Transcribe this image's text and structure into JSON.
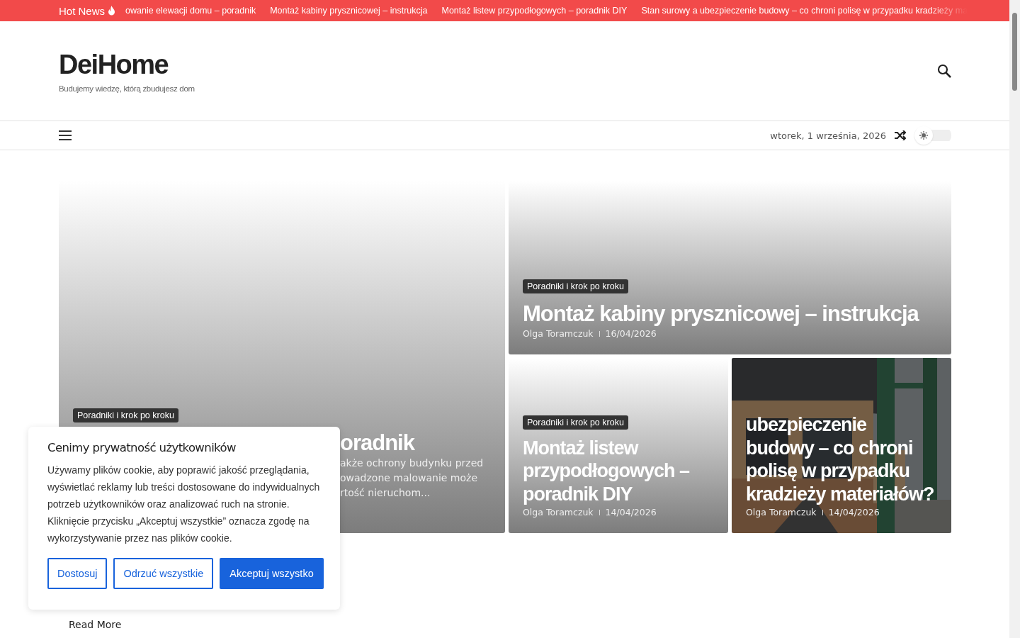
{
  "ticker": {
    "label": "Hot News",
    "items": [
      "owanie elewacji domu – poradnik",
      "Montaż kabiny prysznicowej – instrukcja",
      "Montaż listew przypodłogowych – poradnik DIY",
      "Stan surowy a ubezpieczenie budowy – co chroni polisę w przypadku kradzieży ma"
    ]
  },
  "header": {
    "logo": "DeiHome",
    "tagline": "Budujemy wiedzę, którą zbudujesz dom"
  },
  "nav": {
    "date": "wtorek, 1 września, 2026",
    "dark_mode": false
  },
  "featured": [
    {
      "kind": "large",
      "category": "Poradniki i krok po kroku",
      "title": "oradnik",
      "excerpt_lines": [
        "akże ochrony budynku przed",
        "owadzone malowanie może",
        "rtość nieruchom..."
      ]
    },
    {
      "kind": "wide",
      "category": "Poradniki i krok po kroku",
      "title": "Montaż kabiny prysznicowej – instrukcja",
      "author": "Olga Toramczuk",
      "date": "16/04/2026"
    },
    {
      "kind": "small",
      "category": "Poradniki i krok po kroku",
      "title": "Montaż listew przypodłogowych – poradnik DIY",
      "author": "Olga Toramczuk",
      "date": "14/04/2026"
    },
    {
      "title": "ubezpieczenie budowy – co chroni polisę w przypadku kradzieży materiałów?",
      "author": "Olga Toramczuk",
      "date": "14/04/2026"
    }
  ],
  "latest": {
    "read_more": "Read More"
  },
  "cookie": {
    "title": "Cenimy prywatność użytkowników",
    "text": "Używamy plików cookie, aby poprawić jakość przeglądania, wyświetlać reklamy lub treści dostosowane do indywidualnych potrzeb użytkowników oraz analizować ruch na stronie. Kliknięcie przycisku „Akceptuj wszystkie” oznacza zgodę na wykorzystywanie przez nas plików cookie.",
    "buttons": [
      {
        "label": "Dostosuj",
        "kind": "outline"
      },
      {
        "label": "Odrzuć wszystkie",
        "kind": "outline"
      },
      {
        "label": "Akceptuj wszystko",
        "kind": "primary"
      }
    ]
  }
}
